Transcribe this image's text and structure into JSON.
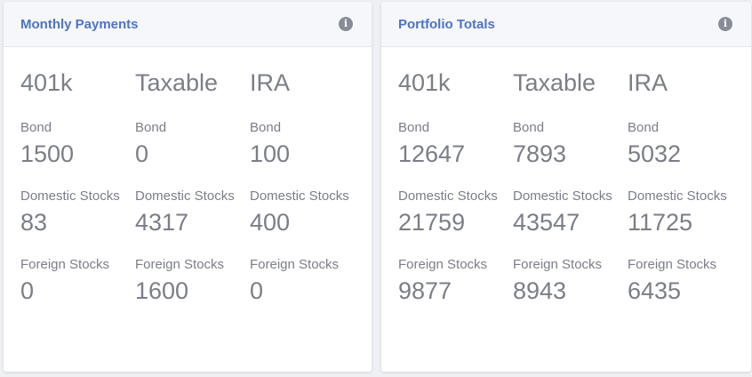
{
  "cards": [
    {
      "title": "Monthly Payments",
      "columns": [
        "401k",
        "Taxable",
        "IRA"
      ],
      "rows": [
        {
          "label": "Bond",
          "values": [
            "1500",
            "0",
            "100"
          ]
        },
        {
          "label": "Domestic Stocks",
          "values": [
            "83",
            "4317",
            "400"
          ]
        },
        {
          "label": "Foreign Stocks",
          "values": [
            "0",
            "1600",
            "0"
          ]
        }
      ]
    },
    {
      "title": "Portfolio Totals",
      "columns": [
        "401k",
        "Taxable",
        "IRA"
      ],
      "rows": [
        {
          "label": "Bond",
          "values": [
            "12647",
            "7893",
            "5032"
          ]
        },
        {
          "label": "Domestic Stocks",
          "values": [
            "21759",
            "43547",
            "11725"
          ]
        },
        {
          "label": "Foreign Stocks",
          "values": [
            "9877",
            "8943",
            "6435"
          ]
        }
      ]
    }
  ],
  "icons": {
    "info": "info-icon"
  },
  "colors": {
    "title": "#4e73c8",
    "text": "#7b7e88",
    "header_bg": "#f5f7fb",
    "icon_bg": "#878c96"
  }
}
